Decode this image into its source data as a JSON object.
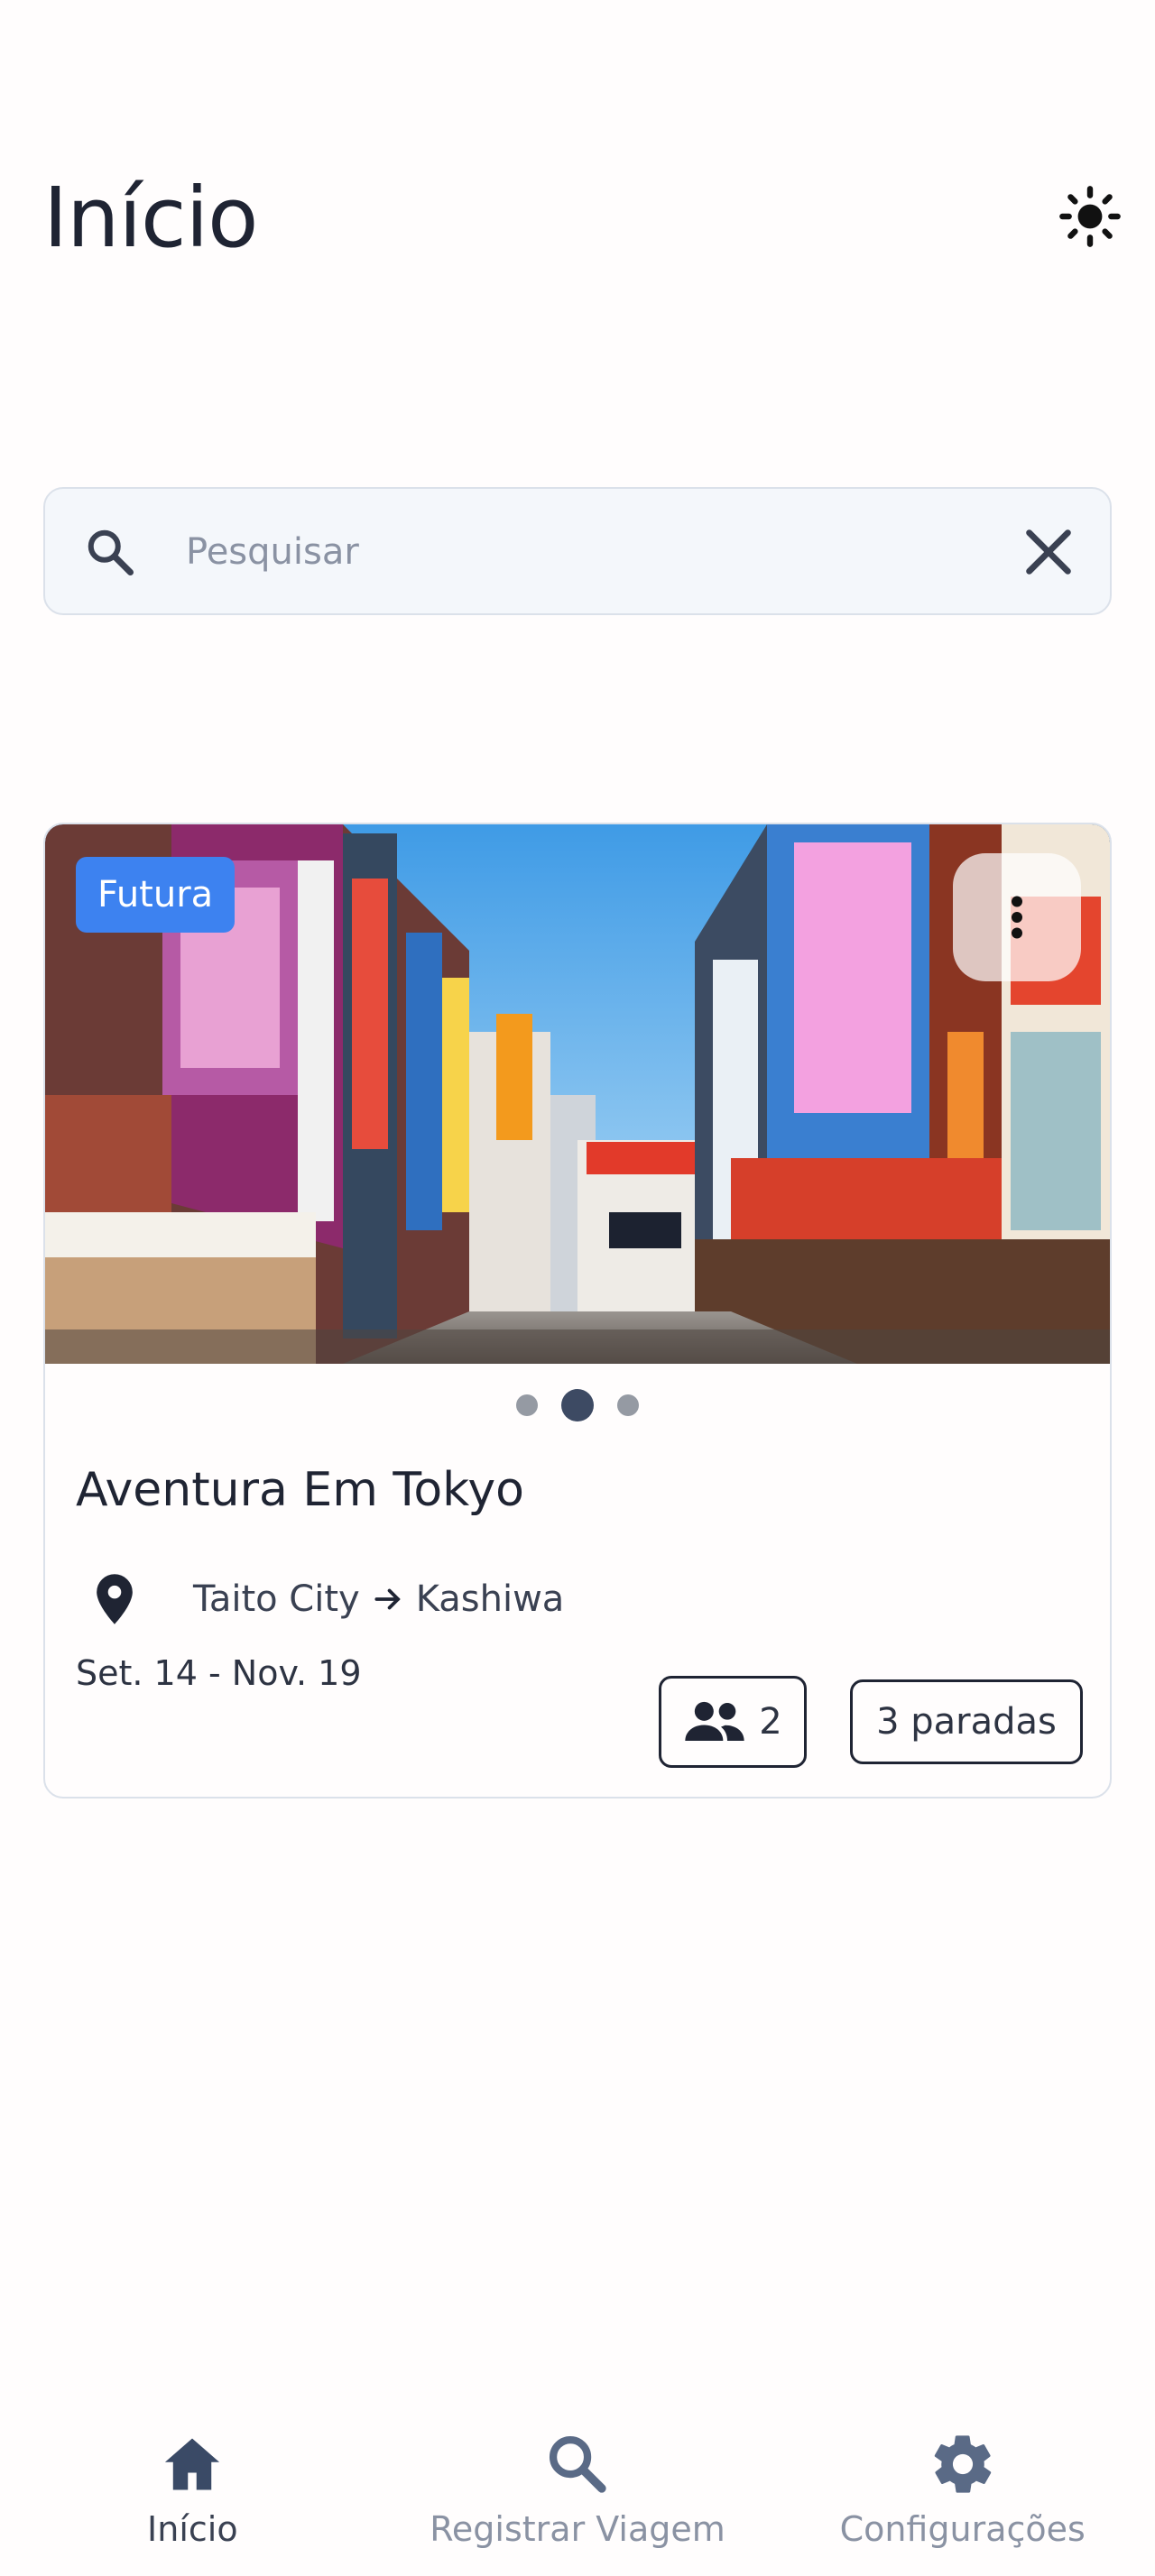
{
  "header": {
    "title": "Início",
    "theme_icon": "sun-icon"
  },
  "search": {
    "placeholder": "Pesquisar",
    "value": ""
  },
  "trip": {
    "status": "Futura",
    "title": "Aventura Em Tokyo",
    "from": "Taito City",
    "to": "Kashiwa",
    "dates": "Set. 14 - Nov. 19",
    "travelers": "2",
    "stops": "3 paradas",
    "image_count": 3,
    "active_image_index": 1
  },
  "nav": {
    "items": [
      {
        "label": "Início",
        "icon": "home-icon",
        "active": true
      },
      {
        "label": "Registrar Viagem",
        "icon": "search-icon",
        "active": false
      },
      {
        "label": "Configurações",
        "icon": "gear-icon",
        "active": false
      }
    ]
  },
  "colors": {
    "accent": "#3d82f0",
    "text": "#1f2433",
    "muted": "#8a92a3",
    "nav_icon": "#5a6a86",
    "search_bg": "#f4f7fb"
  }
}
